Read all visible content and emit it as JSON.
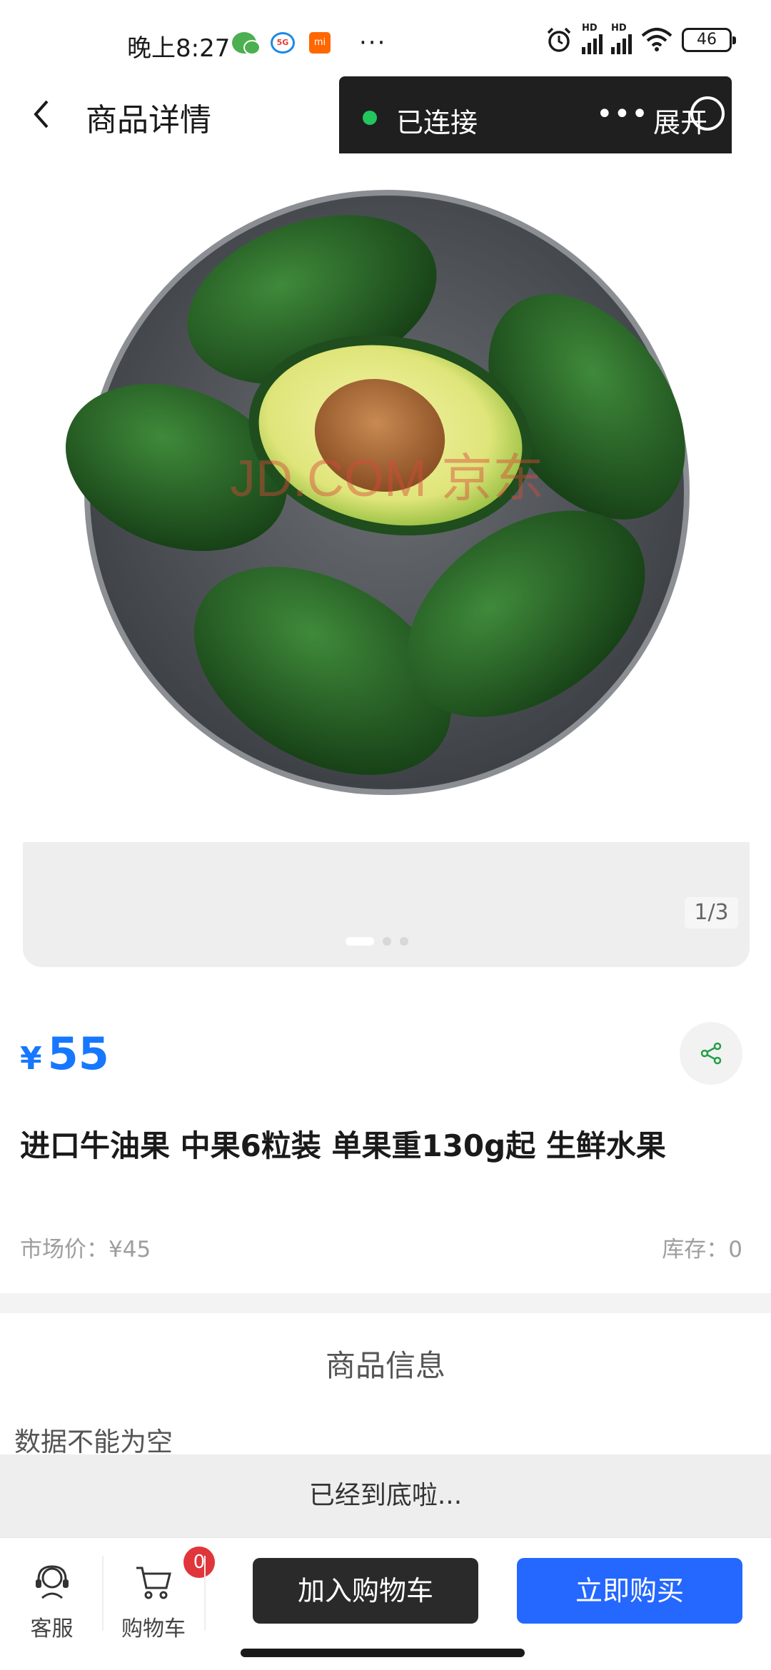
{
  "status_bar": {
    "time": "晚上8:27",
    "battery": "46",
    "signal_label": "HD",
    "more_dots": "···"
  },
  "header": {
    "title": "商品详情"
  },
  "overlay": {
    "status": "已连接",
    "more": "•••",
    "expand": "展开",
    "status_color": "#22c55e"
  },
  "carousel": {
    "counter": "1/3",
    "watermark": "JD.COM 京东",
    "current_index": 1,
    "total": 3
  },
  "product": {
    "currency": "¥",
    "price": "55",
    "title": "进口牛油果 中果6粒装 单果重130g起 生鲜水果",
    "market_price": "市场价：¥45",
    "stock": "库存：0",
    "accent_color": "#1677ff"
  },
  "info_section": {
    "title": "商品信息",
    "empty_text": "数据不能为空"
  },
  "footer_note": "已经到底啦...",
  "action_bar": {
    "customer_service_label": "客服",
    "cart_label": "购物车",
    "cart_count": "0",
    "add_to_cart_label": "加入购物车",
    "buy_now_label": "立即购买",
    "buy_color": "#2568ff"
  }
}
